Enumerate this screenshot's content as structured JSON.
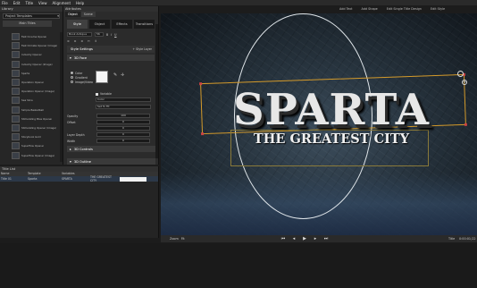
{
  "menu": [
    "File",
    "Edit",
    "Title",
    "View",
    "Alignment",
    "Help"
  ],
  "toolbar_right": [
    "Add Text",
    "Add Shape",
    "Edit Single Title Design",
    "Edit Style"
  ],
  "library": {
    "header": "Library",
    "dropdown": "Project Templates",
    "category": "Main Titles",
    "items": [
      "Fast Cinema Opener",
      "Fast Climate Opener (Image)",
      "Industry Opener",
      "Industry Opener (Image)",
      "Sparta",
      "Operation Opener",
      "Operation Opener (Image)",
      "Sea Slice",
      "Simple Basketball",
      "Stimulating Blue Opener",
      "Stimulating Opener (Image)",
      "Storybook Gold",
      "Superflow Opener",
      "Superflow Opener (Image)"
    ]
  },
  "attributes": {
    "header": "Attributes",
    "top_tabs": [
      "Object",
      "Scene"
    ],
    "tabs": [
      "Style",
      "Object",
      "Effects",
      "Transitions"
    ],
    "font": "Book Antiqua",
    "font_size": "56",
    "style_settings": "Style Settings",
    "style_layer": "+ Style Layer",
    "face_section": "3D Face",
    "fill_options": [
      "Color",
      "Gradient",
      "Image/Video"
    ],
    "variable_label": "Variable",
    "color_field": "Color",
    "set_to_fit": "Set To Fit",
    "fields": [
      {
        "label": "Opacity",
        "value": "100"
      },
      {
        "label": "Offset",
        "value": "0"
      },
      {
        "label": "",
        "value": "0"
      },
      {
        "label": "Layer Depth",
        "value": "0"
      },
      {
        "label": "Width",
        "value": "0"
      }
    ],
    "controls_section": "3D Controls",
    "outline_section": "3D Outline"
  },
  "canvas": {
    "main_title": "SPARTA",
    "subtitle": "THE GREATEST CITY"
  },
  "title_list": {
    "header": "Title List",
    "columns": [
      "Name",
      "Template",
      "Variables"
    ],
    "rows": [
      {
        "name": "Title 01",
        "template": "Sparta",
        "variables": [
          "SPARTA",
          "THE GREATEST CITY"
        ]
      }
    ]
  },
  "transport": {
    "zoom_label": "Zoom",
    "zoom": "Fit",
    "title_label": "Title",
    "timecode": "0:00:01;22"
  },
  "colors": {
    "accent": "#d49a2a",
    "selected_row": "#2c3848"
  }
}
